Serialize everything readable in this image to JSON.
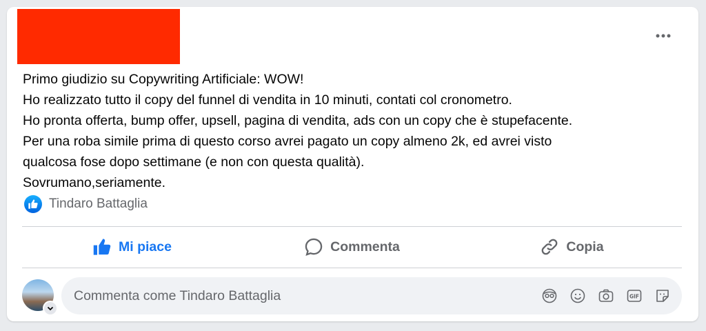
{
  "post": {
    "lines": [
      "Primo giudizio su Copywriting Artificiale: WOW!",
      "Ho realizzato tutto il copy del funnel di vendita in 10 minuti, contati col cronometro.",
      "Ho pronta offerta, bump offer, upsell, pagina di vendita, ads con un copy che è stupefacente.",
      "Per una roba simile prima di questo corso avrei pagato un copy almeno 2k, ed avrei visto",
      "qualcosa fose dopo settimane (e non con questa qualità).",
      "Sovrumano,seriamente."
    ],
    "reactions": {
      "icon": "like-icon",
      "names": "Tindaro Battaglia"
    }
  },
  "actions": {
    "like_label": "Mi piace",
    "comment_label": "Commenta",
    "copy_label": "Copia"
  },
  "comment_input": {
    "placeholder": "Commenta come Tindaro Battaglia",
    "icons": [
      "avatar-sticker-icon",
      "emoji-icon",
      "camera-icon",
      "gif-icon",
      "sticker-icon"
    ]
  },
  "colors": {
    "accent": "#1877f2",
    "redaction": "#ff2a00",
    "muted_text": "#65676b"
  }
}
